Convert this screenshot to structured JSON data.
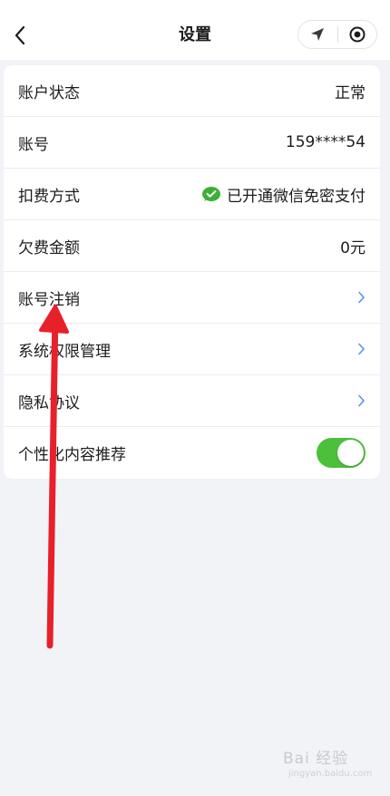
{
  "header": {
    "title": "设置",
    "back_icon": "chevron-left-icon",
    "capsule_icons": [
      "location-arrow-icon",
      "record-circle-icon"
    ]
  },
  "settings": [
    {
      "label": "账户状态",
      "value": "正常",
      "type": "text"
    },
    {
      "label": "账号",
      "value": "159****54",
      "type": "text"
    },
    {
      "label": "扣费方式",
      "value": "已开通微信免密支付",
      "type": "wechat"
    },
    {
      "label": "欠费金额",
      "value": "0元",
      "type": "text"
    },
    {
      "label": "账号注销",
      "type": "link"
    },
    {
      "label": "系统权限管理",
      "type": "link"
    },
    {
      "label": "隐私协议",
      "type": "link"
    },
    {
      "label": "个性化内容推荐",
      "type": "toggle",
      "enabled": true
    }
  ],
  "colors": {
    "toggle_on": "#4cbf3b",
    "chevron": "#5b8ff9",
    "annotation_arrow": "#e8202a"
  },
  "watermark": {
    "text": "Bai 经验",
    "sub": "jingyan.baidu.com"
  }
}
